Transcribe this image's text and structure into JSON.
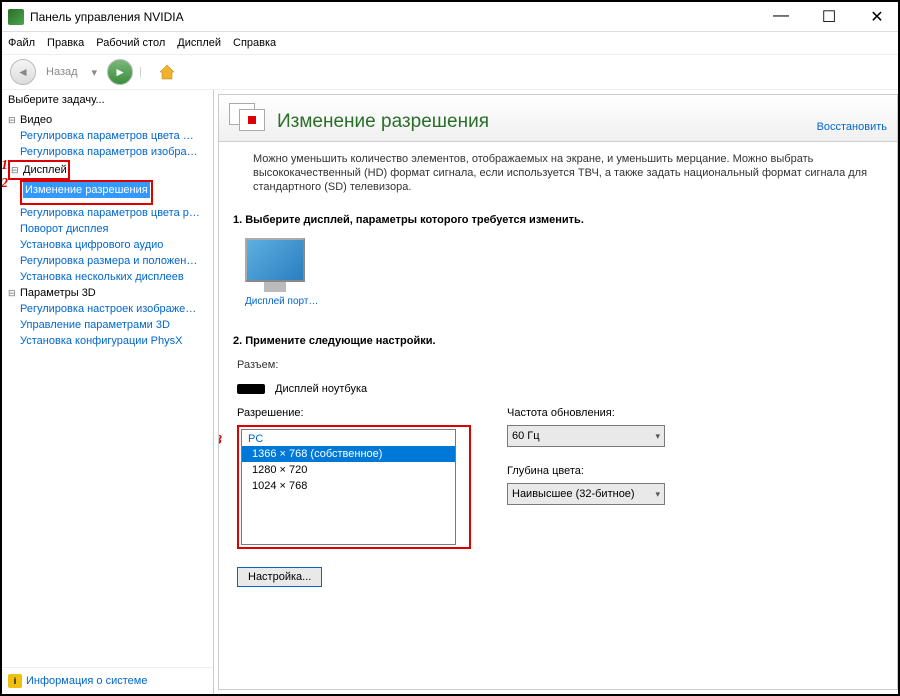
{
  "window": {
    "title": "Панель управления NVIDIA"
  },
  "menubar": [
    "Файл",
    "Правка",
    "Рабочий стол",
    "Дисплей",
    "Справка"
  ],
  "toolbar": {
    "back_label": "Назад"
  },
  "sidebar": {
    "header": "Выберите задачу...",
    "info_link": "Информация о системе",
    "tree": {
      "video_label": "Видео",
      "video_children": [
        "Регулировка параметров цвета для видео",
        "Регулировка параметров изображения для…"
      ],
      "display_label": "Дисплей",
      "display_children": {
        "change_res": "Изменение разрешения",
        "others": [
          "Регулировка параметров цвета рабочего…",
          "Поворот дисплея",
          "Установка цифрового аудио",
          "Регулировка размера и положения рабочего…",
          "Установка нескольких дисплеев"
        ]
      },
      "threed_label": "Параметры 3D",
      "threed_children": [
        "Регулировка настроек изображения с просм…",
        "Управление параметрами 3D",
        "Установка конфигурации PhysX"
      ]
    }
  },
  "content": {
    "title": "Изменение разрешения",
    "restore": "Восстановить",
    "description": "Можно уменьшить количество элементов, отображаемых на экране, и уменьшить мерцание. Можно выбрать высококачественный (HD) формат сигнала, если используется ТВЧ, а также задать национальный формат сигнала для стандартного (SD) телевизора.",
    "step1_title": "1. Выберите дисплей, параметры которого требуется изменить.",
    "display_name": "Дисплей порт…",
    "step2_title": "2. Примените следующие настройки.",
    "connector_label": "Разъем:",
    "connector_value": "Дисплей ноутбука",
    "resolution_label": "Разрешение:",
    "resolutions": {
      "group": "PC",
      "items": [
        "1366 × 768 (собственное)",
        "1280 × 720",
        "1024 × 768"
      ],
      "selected_index": 0
    },
    "refresh_label": "Частота обновления:",
    "refresh_value": "60 Гц",
    "depth_label": "Глубина цвета:",
    "depth_value": "Наивысшее (32-битное)",
    "settings_btn": "Настройка..."
  },
  "annotations": {
    "one": "1",
    "two": "2",
    "three": "3"
  }
}
